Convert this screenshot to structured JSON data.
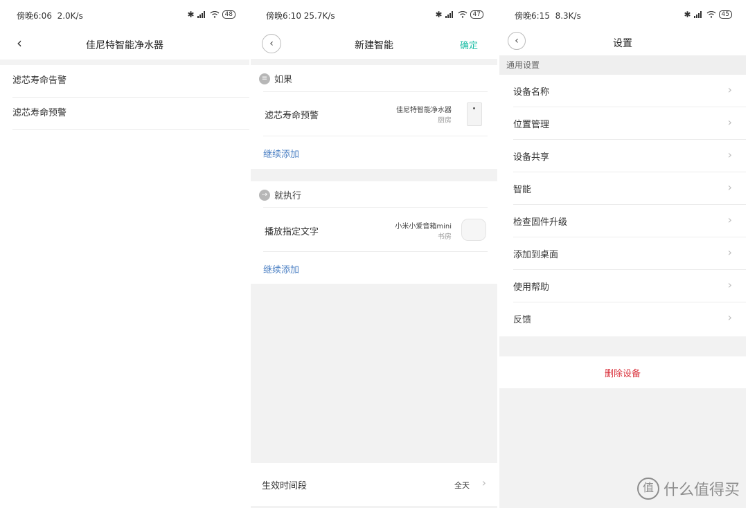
{
  "panel1": {
    "status": {
      "time": "傍晚6:06",
      "speed": "2.0K/s",
      "battery": "48"
    },
    "title": "佳尼特智能净水器",
    "items": [
      "滤芯寿命告警",
      "滤芯寿命预警"
    ]
  },
  "panel2": {
    "status": {
      "time": "傍晚6:10",
      "speed": "25.7K/s",
      "battery": "47"
    },
    "title": "新建智能",
    "confirm": "确定",
    "if_label": "如果",
    "condition": {
      "label": "滤芯寿命预警",
      "device": "佳尼特智能净水器",
      "room": "厨房"
    },
    "add1": "继续添加",
    "then_label": "就执行",
    "action": {
      "label": "播放指定文字",
      "device": "小米小爱音箱mini",
      "room": "书房"
    },
    "add2": "继续添加",
    "period_label": "生效时间段",
    "period_value": "全天"
  },
  "panel3": {
    "status": {
      "time": "傍晚6:15",
      "speed": "8.3K/s",
      "battery": "45"
    },
    "title": "设置",
    "group": "通用设置",
    "items": [
      "设备名称",
      "位置管理",
      "设备共享",
      "智能",
      "检查固件升级",
      "添加到桌面",
      "使用帮助",
      "反馈"
    ],
    "delete": "删除设备"
  },
  "watermark": {
    "logo": "值",
    "text": "什么值得买"
  },
  "icons": {
    "back": "chevron-left-icon",
    "chevron": "chevron-right-icon",
    "if": "list-icon",
    "then": "arrow-right-icon"
  },
  "colors": {
    "accent": "#1dbda5",
    "link": "#4a7fc3",
    "danger": "#d9303a"
  }
}
